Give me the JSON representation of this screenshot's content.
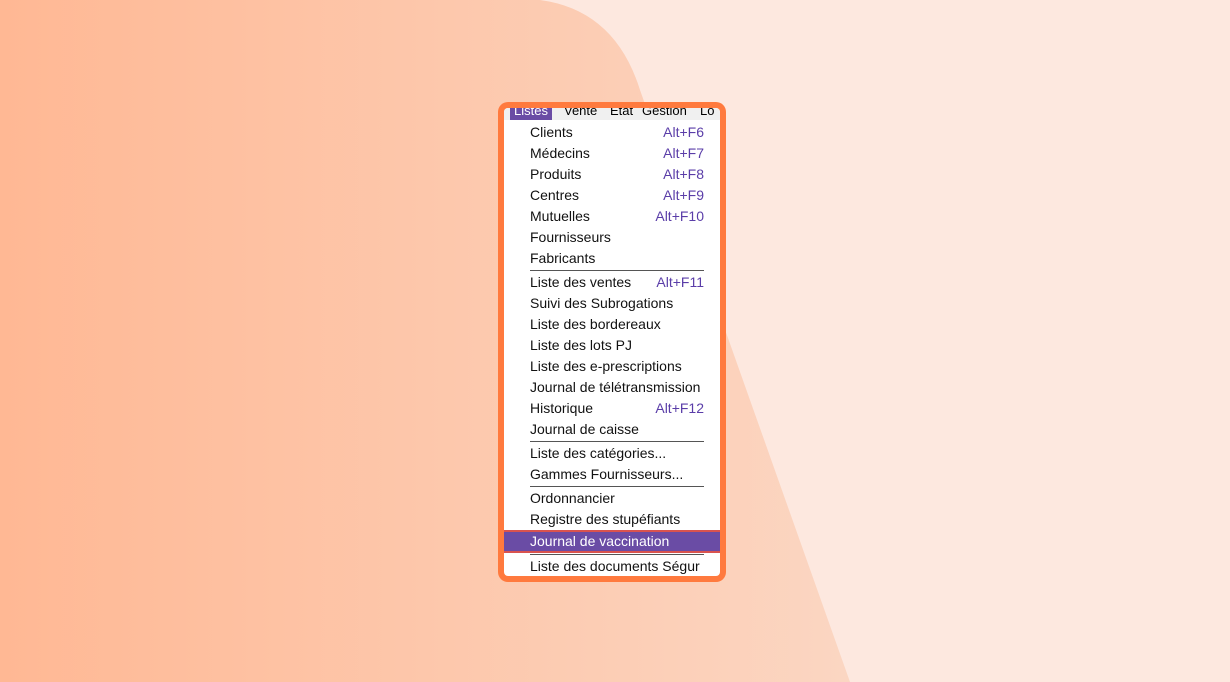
{
  "colors": {
    "frame": "#ff7a3e",
    "highlight": "#6a4ca5",
    "shortcut": "#5a3da8",
    "background_light": "#fde8df",
    "background_dark": "#ffb894"
  },
  "menubar": {
    "items": [
      "Listes",
      "Vente",
      "Etat",
      "Gestion",
      "Lo"
    ],
    "active": "Listes"
  },
  "menu": {
    "items": [
      {
        "label": "Clients",
        "shortcut": "Alt+F6"
      },
      {
        "label": "Médecins",
        "shortcut": "Alt+F7"
      },
      {
        "label": "Produits",
        "shortcut": "Alt+F8"
      },
      {
        "label": "Centres",
        "shortcut": "Alt+F9"
      },
      {
        "label": "Mutuelles",
        "shortcut": "Alt+F10"
      },
      {
        "label": "Fournisseurs",
        "shortcut": ""
      },
      {
        "label": "Fabricants",
        "shortcut": ""
      },
      {
        "label": "Liste des ventes",
        "shortcut": "Alt+F11"
      },
      {
        "label": "Suivi des Subrogations",
        "shortcut": ""
      },
      {
        "label": "Liste des bordereaux",
        "shortcut": ""
      },
      {
        "label": "Liste des lots PJ",
        "shortcut": ""
      },
      {
        "label": "Liste des e-prescriptions",
        "shortcut": ""
      },
      {
        "label": "Journal de télétransmission",
        "shortcut": ""
      },
      {
        "label": "Historique",
        "shortcut": "Alt+F12"
      },
      {
        "label": "Journal de caisse",
        "shortcut": ""
      },
      {
        "label": "Liste des catégories...",
        "shortcut": ""
      },
      {
        "label": "Gammes Fournisseurs...",
        "shortcut": ""
      },
      {
        "label": "Ordonnancier",
        "shortcut": ""
      },
      {
        "label": "Registre des stupéfiants",
        "shortcut": ""
      },
      {
        "label": "Journal de vaccination",
        "shortcut": ""
      },
      {
        "label": "Liste des documents Ségur",
        "shortcut": ""
      }
    ],
    "highlighted": "Journal de vaccination"
  }
}
